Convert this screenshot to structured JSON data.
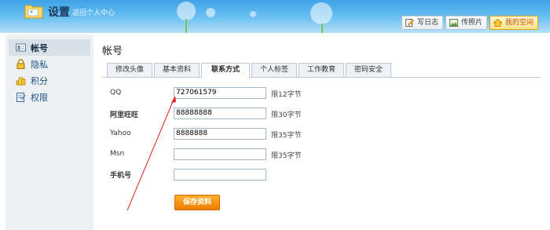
{
  "header": {
    "title": "设置",
    "back_link": "返回个人中心",
    "buttons": [
      {
        "label": "写日志",
        "icon": "pencil-note-icon"
      },
      {
        "label": "传照片",
        "icon": "photo-icon"
      },
      {
        "label": "我的空间",
        "icon": "home-icon"
      }
    ]
  },
  "sidebar": {
    "items": [
      {
        "label": "帐号",
        "icon": "account-card-icon"
      },
      {
        "label": "隐私",
        "icon": "lock-icon"
      },
      {
        "label": "积分",
        "icon": "coin-icon"
      },
      {
        "label": "权限",
        "icon": "permission-icon"
      }
    ]
  },
  "main": {
    "title": "帐号",
    "tabs": [
      {
        "label": "修改头像"
      },
      {
        "label": "基本资料"
      },
      {
        "label": "联系方式"
      },
      {
        "label": "个人标签"
      },
      {
        "label": "工作教育"
      },
      {
        "label": "密码安全"
      }
    ],
    "fields": [
      {
        "label": "QQ",
        "value": "727061579",
        "limit": "限12字节"
      },
      {
        "label": "阿里旺旺",
        "value": "88888888",
        "limit": "限30字节"
      },
      {
        "label": "Yahoo",
        "value": "8888888",
        "limit": "限35字节"
      },
      {
        "label": "Msn",
        "value": "",
        "limit": "限35字节"
      },
      {
        "label": "手机号",
        "value": ""
      }
    ],
    "save_label": "保存资料"
  },
  "colors": {
    "header_top": "#3fa2e6",
    "accent_orange": "#f07d00",
    "link_blue": "#1c4e80",
    "annotation_red": "#e02020"
  }
}
